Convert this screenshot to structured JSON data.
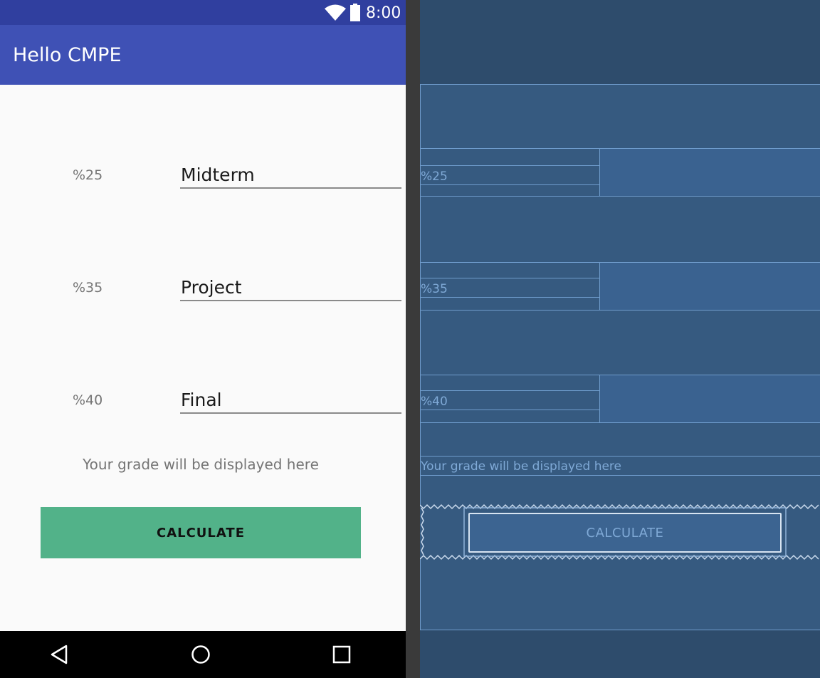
{
  "status_bar": {
    "time": "8:00"
  },
  "app_bar": {
    "title": "Hello CMPE"
  },
  "form": {
    "rows": [
      {
        "weight": "%25",
        "value": "Midterm"
      },
      {
        "weight": "%35",
        "value": "Project"
      },
      {
        "weight": "%40",
        "value": "Final"
      }
    ],
    "result_text": "Your grade will be displayed here",
    "calculate_label": "CALCULATE"
  },
  "blueprint": {
    "weights": [
      "%25",
      "%35",
      "%40"
    ],
    "result_text": "Your grade will be displayed here",
    "calculate_label": "CALCULATE"
  },
  "icons": {
    "wifi": "wifi-icon",
    "battery": "battery-icon",
    "back": "back-triangle-icon",
    "home": "home-circle-icon",
    "recents": "recents-square-icon"
  },
  "colors": {
    "status_bar": "#303f9f",
    "app_bar": "#3f51b5",
    "button": "#52b289",
    "blueprint_bg": "#2e4c6c"
  }
}
